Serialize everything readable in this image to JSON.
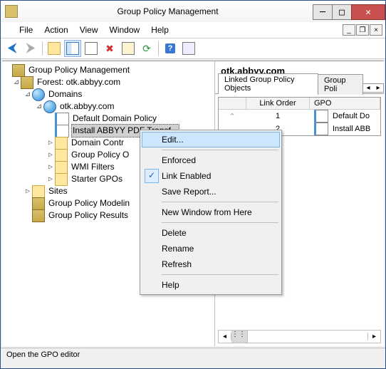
{
  "window": {
    "title": "Group Policy Management"
  },
  "menu": {
    "file": "File",
    "action": "Action",
    "view": "View",
    "window": "Window",
    "help": "Help"
  },
  "tree": {
    "root": "Group Policy Management",
    "forest": "Forest: otk.abbyy.com",
    "domains": "Domains",
    "domain": "otk.abbyy.com",
    "ddp": "Default Domain Policy",
    "install": "Install ABBYY PDF Transf...",
    "dc": "Domain Contr",
    "gpo": "Group Policy O",
    "wmi": "WMI Filters",
    "starter": "Starter GPOs",
    "sites": "Sites",
    "gpm": "Group Policy Modelin",
    "gpr": "Group Policy Results"
  },
  "right": {
    "title": "otk.abbyy.com",
    "tab1": "Linked Group Policy Objects",
    "tab2": "Group Poli",
    "col_order": "Link Order",
    "col_gpo": "GPO",
    "rows": [
      {
        "order": "1",
        "gpo": "Default Do"
      },
      {
        "order": "2",
        "gpo": "Install ABB"
      }
    ]
  },
  "context": {
    "edit": "Edit...",
    "enforced": "Enforced",
    "link_enabled": "Link Enabled",
    "save_report": "Save Report...",
    "new_window": "New Window from Here",
    "delete": "Delete",
    "rename": "Rename",
    "refresh": "Refresh",
    "help": "Help"
  },
  "status": "Open the GPO editor"
}
